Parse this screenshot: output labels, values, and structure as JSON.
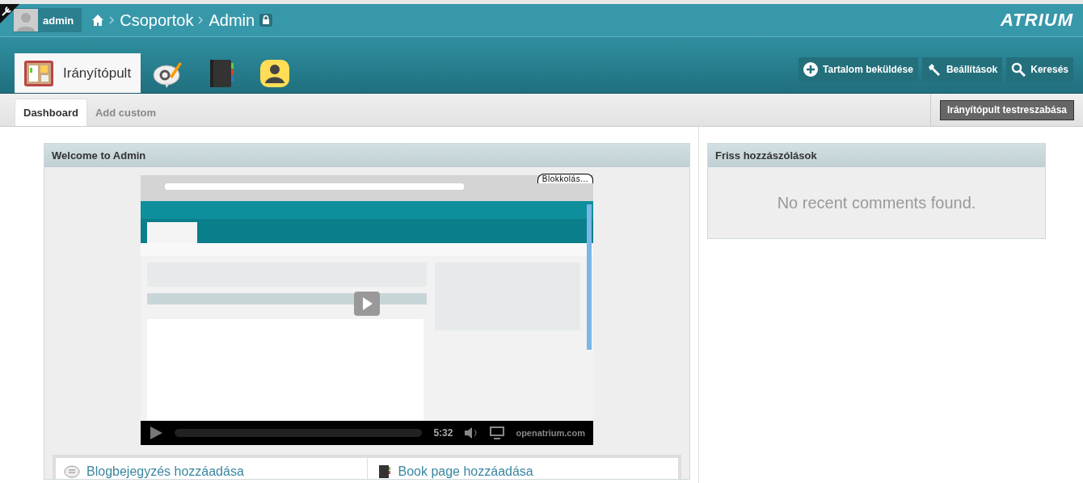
{
  "top_bar": {
    "user": "admin",
    "breadcrumb": [
      {
        "label": "Csoportok",
        "locked": false
      },
      {
        "label": "Admin",
        "locked": true
      }
    ],
    "logo": "ATRIUM"
  },
  "app_tabs": [
    {
      "kind": "dashboard",
      "label": "Irányítópult",
      "selected": true
    },
    {
      "kind": "blog",
      "selected": false
    },
    {
      "kind": "book",
      "selected": false
    },
    {
      "kind": "profile",
      "selected": false
    }
  ],
  "actions": [
    {
      "kind": "add",
      "label": "Tartalom beküldése"
    },
    {
      "kind": "settings",
      "label": "Beállítások"
    },
    {
      "kind": "search",
      "label": "Keresés"
    }
  ],
  "subtabs": [
    {
      "label": "Dashboard",
      "selected": true
    },
    {
      "label": "Add custom",
      "selected": false
    }
  ],
  "customize_button": "Irányítópult testreszabása",
  "welcome_panel": {
    "title": "Welcome to Admin",
    "video": {
      "kind": "picture",
      "overlay_tab": "Blokkolás...",
      "duration": "5:32",
      "brand": "openatrium.com"
    },
    "links": [
      {
        "kind": "blog",
        "label": "Blogbejegyzés hozzáadása"
      },
      {
        "kind": "book",
        "label": "Book page hozzáadása"
      }
    ]
  },
  "comments_panel": {
    "title": "Friss hozzászólások",
    "empty_text": "No recent comments found."
  }
}
